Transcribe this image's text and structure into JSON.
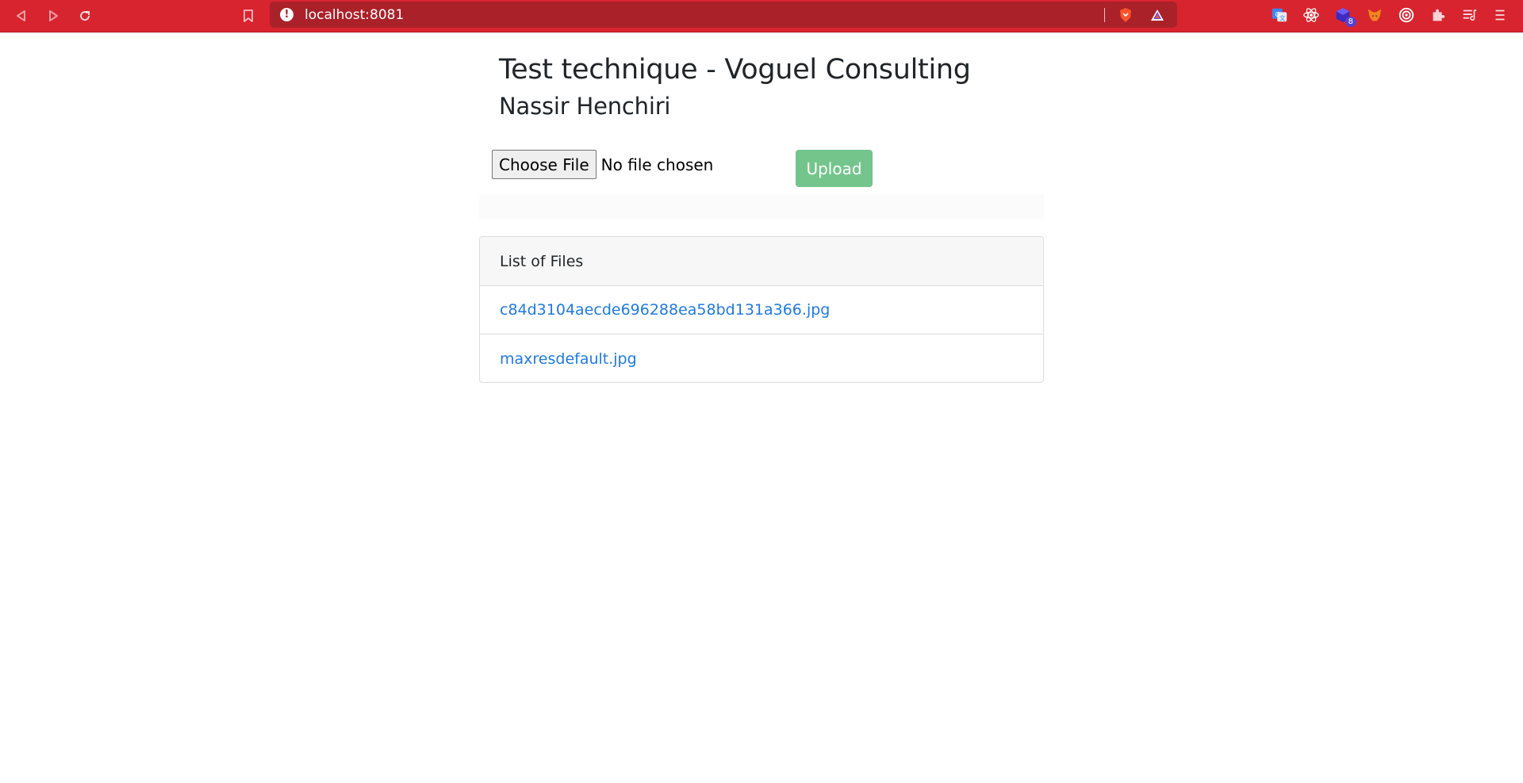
{
  "browser": {
    "url": "localhost:8081",
    "info_icon_glyph": "!",
    "extensions": [
      {
        "icon": "google-translate-icon"
      },
      {
        "icon": "react-devtools-icon"
      },
      {
        "icon": "cube-extension-icon",
        "badge": "8"
      },
      {
        "icon": "metamask-fox-icon"
      },
      {
        "icon": "target-extension-icon"
      },
      {
        "icon": "puzzle-extensions-icon"
      },
      {
        "icon": "playlist-icon"
      },
      {
        "icon": "menu-icon"
      }
    ],
    "colors": {
      "toolbar": "#d8242f",
      "urlbar": "#ab2129"
    }
  },
  "page": {
    "title": "Test technique - Voguel Consulting",
    "subtitle": "Nassir Henchiri"
  },
  "upload": {
    "choose_label": "Choose File",
    "no_file_text": "No file chosen",
    "upload_label": "Upload",
    "upload_color": "#74c58b"
  },
  "files": {
    "header": "List of Files",
    "items": [
      {
        "name": "c84d3104aecde696288ea58bd131a366.jpg"
      },
      {
        "name": "maxresdefault.jpg"
      }
    ],
    "link_color": "#1f7ae0"
  }
}
